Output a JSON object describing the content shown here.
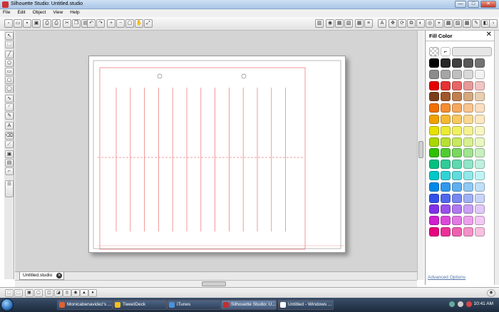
{
  "window": {
    "title": "Silhouette Studio: Untitled.studio",
    "minimize": "—",
    "maximize": "□",
    "close": "✕"
  },
  "menu": [
    "File",
    "Edit",
    "Object",
    "View",
    "Help"
  ],
  "fill_panel": {
    "title": "Fill Color",
    "close": "✕",
    "advanced": "Advanced Options"
  },
  "document_tab": {
    "label": "Untitled.studio",
    "close": "✕"
  },
  "taskbar": {
    "items": [
      {
        "label": "Monicabenavidez's ...",
        "color": "#e06030"
      },
      {
        "label": "TweetDeck",
        "color": "#f0c020"
      },
      {
        "label": "iTunes",
        "color": "#4a90d9"
      },
      {
        "label": "Silhouette Studio: U...",
        "color": "#c03030"
      },
      {
        "label": "Untitled - Windows ...",
        "color": "#ffffff"
      }
    ],
    "clock": "10:41 AM"
  },
  "swatch_rows": [
    [
      "#000000",
      "#262626",
      "#404040",
      "#595959",
      "#737373"
    ],
    [
      "#8c8c8c",
      "#a6a6a6",
      "#bfbfbf",
      "#d9d9d9",
      "#f2f2f2"
    ],
    [
      "#e60000",
      "#e63333",
      "#e66666",
      "#e69999",
      "#f2c4c4"
    ],
    [
      "#7a3f1a",
      "#a0582a",
      "#c08050",
      "#d4a880",
      "#e8cfb0"
    ],
    [
      "#f07000",
      "#f58c30",
      "#f7a860",
      "#f9c490",
      "#fbdfc0"
    ],
    [
      "#f0a000",
      "#f5b830",
      "#f7c860",
      "#fad890",
      "#fce9c0"
    ],
    [
      "#e8e000",
      "#eceb30",
      "#f0ef60",
      "#f4f290",
      "#f8f6c0"
    ],
    [
      "#a8d800",
      "#b8e030",
      "#c8e860",
      "#d8f090",
      "#e8f8c0"
    ],
    [
      "#30c000",
      "#50cc30",
      "#78d860",
      "#a0e490",
      "#c8f0c0"
    ],
    [
      "#00c080",
      "#30cc98",
      "#60d8b0",
      "#90e4c8",
      "#c0f0e0"
    ],
    [
      "#00c8c8",
      "#30d4d4",
      "#60dcdc",
      "#90e8e8",
      "#c0f4f4"
    ],
    [
      "#0088e8",
      "#3098ec",
      "#60b0f0",
      "#90c8f4",
      "#c0e0f8"
    ],
    [
      "#3050e8",
      "#5068ec",
      "#7888f0",
      "#a0b0f4",
      "#c8d4f8"
    ],
    [
      "#8030e8",
      "#9850ec",
      "#b078f0",
      "#c8a0f4",
      "#e0c8f8"
    ],
    [
      "#d020d0",
      "#dc48dc",
      "#e478e4",
      "#eca0ec",
      "#f4c8f4"
    ],
    [
      "#e80080",
      "#ec3098",
      "#f060b0",
      "#f490c8",
      "#f8c0e0"
    ]
  ]
}
